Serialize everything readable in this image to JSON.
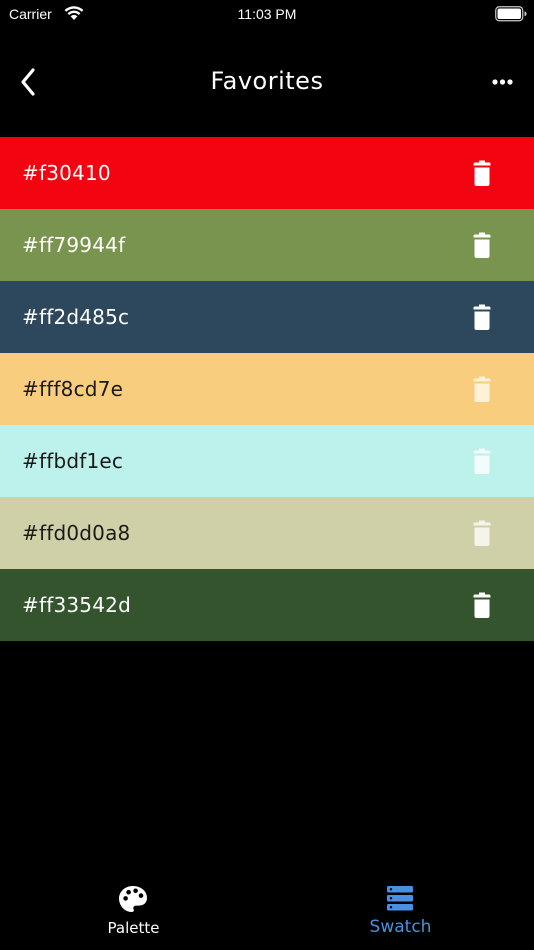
{
  "status_bar": {
    "carrier": "Carrier",
    "time": "11:03 PM"
  },
  "nav": {
    "title": "Favorites",
    "back_icon": "chevron-left-icon",
    "more_icon": "ellipsis-icon"
  },
  "swatches": [
    {
      "label": "#f30410",
      "color": "#f30410",
      "text_color": "#ffffff",
      "icon_color": "#ffffff"
    },
    {
      "label": "#ff79944f",
      "color": "#79944f",
      "text_color": "#ffffff",
      "icon_color": "#ffffff"
    },
    {
      "label": "#ff2d485c",
      "color": "#2d485c",
      "text_color": "#ffffff",
      "icon_color": "#ffffff"
    },
    {
      "label": "#fff8cd7e",
      "color": "#f8cd7e",
      "text_color": "#1a1a1a",
      "icon_color": "#fdf1d8"
    },
    {
      "label": "#ffbdf1ec",
      "color": "#bdf1ec",
      "text_color": "#1a1a1a",
      "icon_color": "#f2fcfb"
    },
    {
      "label": "#ffd0d0a8",
      "color": "#d0d0a8",
      "text_color": "#1a1a1a",
      "icon_color": "#f4f4ea"
    },
    {
      "label": "#ff33542d",
      "color": "#33542d",
      "text_color": "#ffffff",
      "icon_color": "#ffffff"
    }
  ],
  "tabs": [
    {
      "label": "Palette",
      "icon": "palette-icon",
      "active": false,
      "color": "#ffffff"
    },
    {
      "label": "Swatch",
      "icon": "swatch-list-icon",
      "active": true,
      "color": "#4a90e2"
    }
  ]
}
